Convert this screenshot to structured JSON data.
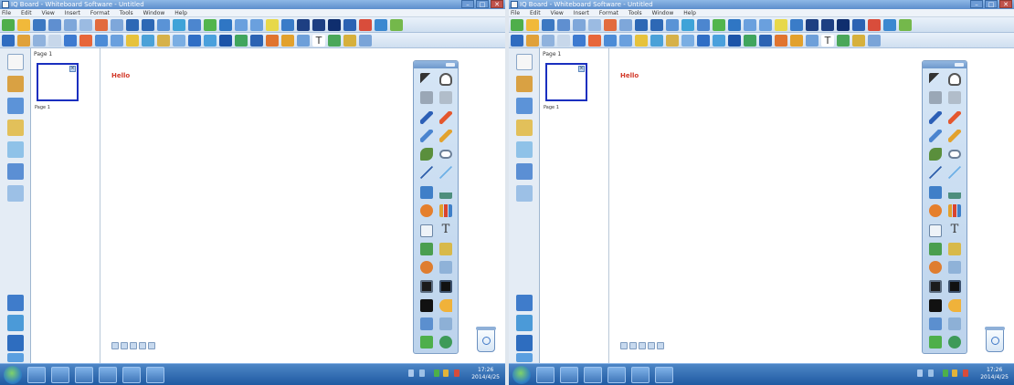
{
  "window": {
    "title": "IQ Board - Whiteboard Software - Untitled",
    "controls": {
      "minimize": "–",
      "maximize": "□",
      "close": "✕"
    }
  },
  "menu": {
    "items": [
      "File",
      "Edit",
      "View",
      "Insert",
      "Format",
      "Tools",
      "Window",
      "Help"
    ]
  },
  "thumbnails": {
    "title": "Page 1",
    "items": [
      {
        "label": "Page 1",
        "close": "×"
      }
    ]
  },
  "canvas": {
    "text": "Hello"
  },
  "toolpanel": {
    "text_tool": "T"
  },
  "taskbar": {
    "clock_time": "17:26",
    "clock_date": "2014/4/25"
  },
  "colors": {
    "titlebar": "#5d8ecc",
    "panel": "#bcd3ec",
    "taskbar": "#1f5aa2",
    "accent_red": "#d23a2a",
    "thumb_border": "#1a2fbf"
  }
}
